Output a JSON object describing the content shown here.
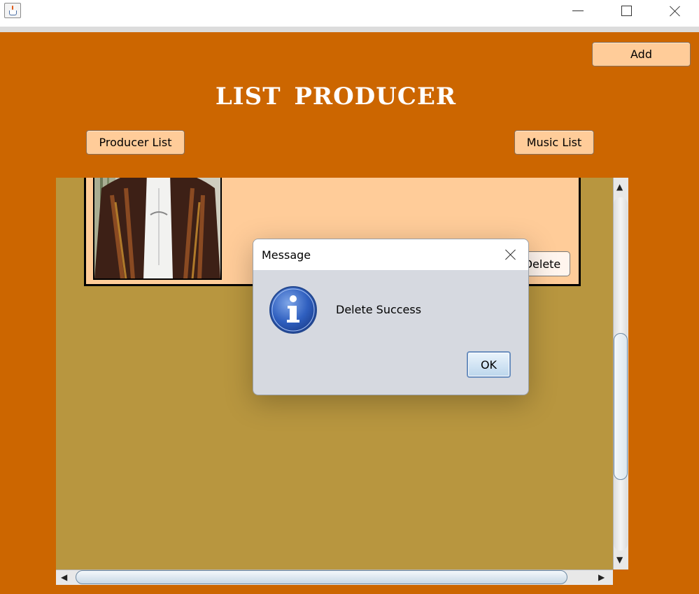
{
  "window": {
    "controls": [
      "minimize",
      "maximize",
      "close"
    ]
  },
  "header": {
    "title": "LIST  PRODUCER",
    "add_label": "Add",
    "producer_list_label": "Producer List",
    "music_list_label": "Music List"
  },
  "card": {
    "delete_label": "Delete"
  },
  "dialog": {
    "title": "Message",
    "message": "Delete Success",
    "ok_label": "OK",
    "icon": "info-icon"
  },
  "colors": {
    "background": "#cc6600",
    "list_area": "#b8963f",
    "card": "#ffcc99",
    "button": "#ffcc99",
    "dialog_body": "#d6d9e0"
  }
}
